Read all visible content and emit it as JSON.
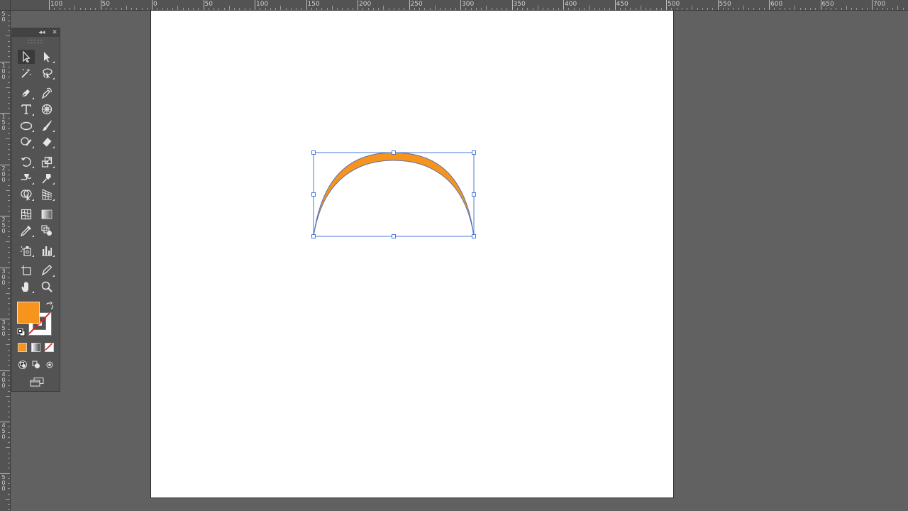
{
  "ruler_horizontal": {
    "labels": [
      "100",
      "50",
      "0",
      "50",
      "100",
      "150",
      "200",
      "250",
      "300",
      "350",
      "400",
      "450",
      "500",
      "550",
      "600",
      "650",
      "700"
    ]
  },
  "ruler_vertical": {
    "labels": [
      "5\n0",
      "1\n0\n0",
      "1\n5\n0",
      "2\n0\n0",
      "2\n5\n0",
      "3\n0\n0",
      "3\n5\n0",
      "4\n0\n0",
      "4\n5\n0",
      "5\n0\n0"
    ]
  },
  "colors": {
    "fill": "#f7941d",
    "selection": "#4a78d9",
    "path_stroke": "#5b6fb0"
  },
  "toolbar": {
    "collapse_icon": "double-chevron-left-icon",
    "close_icon": "close-icon",
    "tools": [
      {
        "name": "selection-tool-icon",
        "active": true
      },
      {
        "name": "direct-selection-tool-icon",
        "active": false
      },
      {
        "name": "magic-wand-tool-icon",
        "active": false
      },
      {
        "name": "lasso-tool-icon",
        "active": false
      },
      {
        "name": "pen-tool-icon",
        "active": false
      },
      {
        "name": "curvature-tool-icon",
        "active": false
      },
      {
        "name": "type-tool-icon",
        "active": false
      },
      {
        "name": "flare-tool-icon",
        "active": false
      },
      {
        "name": "ellipse-tool-icon",
        "active": false
      },
      {
        "name": "paintbrush-tool-icon",
        "active": false
      },
      {
        "name": "shaper-tool-icon",
        "active": false
      },
      {
        "name": "eraser-tool-icon",
        "active": false
      },
      {
        "name": "rotate-tool-icon",
        "active": false
      },
      {
        "name": "scale-tool-icon",
        "active": false
      },
      {
        "name": "warp-tool-icon",
        "active": false
      },
      {
        "name": "puppet-warp-tool-icon",
        "active": false
      },
      {
        "name": "shape-builder-tool-icon",
        "active": false
      },
      {
        "name": "perspective-grid-tool-icon",
        "active": false
      },
      {
        "name": "mesh-tool-icon",
        "active": false
      },
      {
        "name": "gradient-tool-icon",
        "active": false
      },
      {
        "name": "eyedropper-tool-icon",
        "active": false
      },
      {
        "name": "blend-tool-icon",
        "active": false
      },
      {
        "name": "symbol-sprayer-tool-icon",
        "active": false
      },
      {
        "name": "column-graph-tool-icon",
        "active": false
      },
      {
        "name": "artboard-tool-icon",
        "active": false
      },
      {
        "name": "slice-tool-icon",
        "active": false
      },
      {
        "name": "hand-tool-icon",
        "active": false
      },
      {
        "name": "zoom-tool-icon",
        "active": false
      }
    ]
  }
}
